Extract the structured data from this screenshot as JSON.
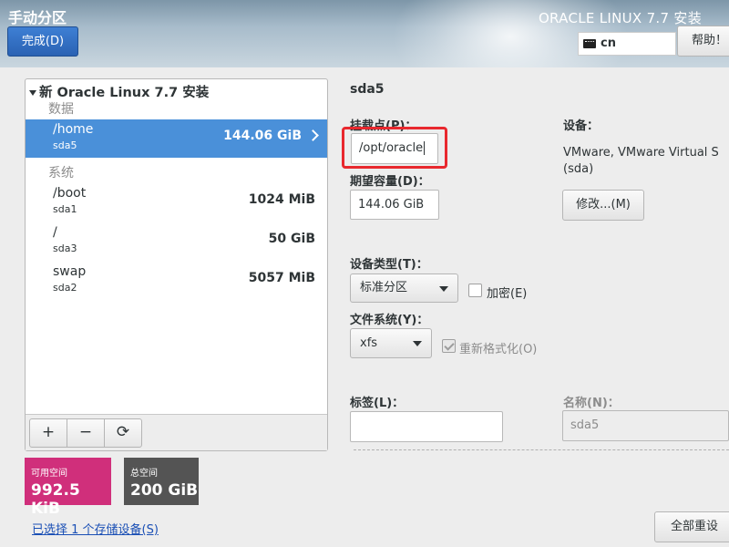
{
  "header": {
    "title": "手动分区",
    "done_label": "完成(D)",
    "product": "ORACLE LINUX 7.7 安装",
    "keyboard_layout": "cn",
    "help_label": "帮助！"
  },
  "left": {
    "install_title": "新 Oracle Linux 7.7 安装",
    "sections": [
      {
        "label": "数据",
        "items": [
          {
            "name": "/home",
            "device": "sda5",
            "size": "144.06 GiB",
            "selected": true
          }
        ]
      },
      {
        "label": "系统",
        "items": [
          {
            "name": "/boot",
            "device": "sda1",
            "size": "1024 MiB"
          },
          {
            "name": "/",
            "device": "sda3",
            "size": "50 GiB"
          },
          {
            "name": "swap",
            "device": "sda2",
            "size": "5057 MiB"
          }
        ]
      }
    ],
    "toolbar": {
      "add": "+",
      "remove": "−",
      "refresh": "⟳"
    }
  },
  "space": {
    "available_label": "可用空间",
    "available_value": "992.5 KiB",
    "total_label": "总空间",
    "total_value": "200 GiB",
    "storage_link": "已选择 1 个存储设备(S)"
  },
  "detail": {
    "title": "sda5",
    "mount_label": "挂载点(P)：",
    "mount_value": "/opt/oracle",
    "capacity_label": "期望容量(D)：",
    "capacity_value": "144.06 GiB",
    "device_label": "设备：",
    "device_value_line1": "VMware, VMware Virtual S",
    "device_value_line2": "(sda)",
    "modify_label": "修改...(M)",
    "device_type_label": "设备类型(T)：",
    "device_type_value": "标准分区",
    "encrypt_label": "加密(E)",
    "encrypt_checked": false,
    "fs_label": "文件系统(Y)：",
    "fs_value": "xfs",
    "reformat_label": "重新格式化(O)",
    "reformat_checked": true,
    "tag_label": "标签(L)：",
    "tag_value": "",
    "name_label": "名称(N)：",
    "name_value": "sda5",
    "reset_label": "全部重设(R)"
  },
  "colors": {
    "accent": "#4a90d9",
    "available_tile": "#d02f7b",
    "total_tile": "#545454",
    "highlight": "#e8282e"
  }
}
